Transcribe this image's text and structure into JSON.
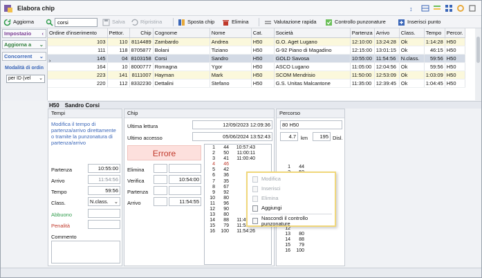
{
  "window": {
    "title": "Elabora chip"
  },
  "toolbar": {
    "aggiorna": "Aggiorna",
    "search_value": "corsi",
    "salva": "Salva",
    "ripristina": "Ripristina",
    "sposta_chip": "Sposta chip",
    "elimina": "Elimina",
    "valutazione_rapida": "Valutazione rapida",
    "controllo_punzonature": "Controllo punzonature",
    "inserisci_punto": "Inserisci punto"
  },
  "left": {
    "impostazioni": "Impostazio",
    "aggiorna_a": "Aggiorna a",
    "concorrenti": "Concorrent",
    "modalita": "Modalità di ordin",
    "per_id": "per ID (vel"
  },
  "grid": {
    "headers": [
      "Ordine d'inserimento",
      "Pettor.",
      "Chip",
      "Cognome",
      "Nome",
      "Cat.",
      "Società",
      "Partenza",
      "Arrivo",
      "Class.",
      "Tempo",
      "Percor."
    ],
    "rows": [
      [
        "103",
        "110",
        "8114489",
        "Zambardo",
        "Andrea",
        "H50",
        "G.O. Aget Lugano",
        "12:10:00",
        "13:24:28",
        "Ok",
        "1:14:28",
        "H50"
      ],
      [
        "111",
        "118",
        "8705877",
        "Bolani",
        "Tiziano",
        "H50",
        "G-92 Piano di Magadino",
        "12:15:00",
        "13:01:15",
        "Ok",
        "46:15",
        "H50"
      ],
      [
        "145",
        "04",
        "8103158",
        "Corsi",
        "Sandro",
        "H50",
        "GOLD Savosa",
        "10:55:00",
        "11:54:56",
        "N.class.",
        "59:56",
        "H50"
      ],
      [
        "164",
        "10",
        "8000777",
        "Romagna",
        "Ygor",
        "H50",
        "ASCO Lugano",
        "11:05:00",
        "12:04:56",
        "Ok",
        "59:56",
        "H50"
      ],
      [
        "223",
        "141",
        "8111007",
        "Hayman",
        "Mark",
        "H50",
        "SCOM Mendrisio",
        "11:50:00",
        "12:53:09",
        "Ok",
        "1:03:09",
        "H50"
      ],
      [
        "220",
        "112",
        "8332230",
        "Dettalini",
        "Stefano",
        "H50",
        "G.S. Unitas Malcantone",
        "11:35:00",
        "12:39:45",
        "Ok",
        "1:04:45",
        "H50"
      ]
    ]
  },
  "detail": {
    "cat": "H50",
    "name": "Sandro Corsi"
  },
  "tempi": {
    "header": "Tempi",
    "note": "Modifica il tempo di partenza/arrivo direttamente o tramite la punzonatura di partenza/arrivo",
    "partenza_label": "Partenza",
    "partenza_value": "10:55:00",
    "arrivo_label": "Arrivo",
    "arrivo_value": "11:54:56",
    "tempo_label": "Tempo",
    "tempo_value": "59:56",
    "class_label": "Class.",
    "class_value": "N.class.",
    "abbuono_label": "Abbuono",
    "penalita_label": "Penalità",
    "commento_label": "Commento"
  },
  "chip": {
    "header": "Chip",
    "ultima_lettura_label": "Ultima lettura",
    "ultima_lettura_value": "12/09/2023 12:09:36",
    "ultimo_accesso_label": "Ultimo accesso",
    "ultimo_accesso_value": "05/06/2024 13:52:43",
    "errore": "Errore",
    "elimina_label": "Elimina",
    "verifica_label": "Verifica",
    "verifica_value": "10:54:00",
    "partenza_label": "Partenza",
    "arrivo_label": "Arrivo",
    "arrivo_value": "11:54:55",
    "punches": [
      [
        "1",
        "44",
        "10:57:43"
      ],
      [
        "2",
        "50",
        "11:00:11"
      ],
      [
        "3",
        "41",
        "11:00:40"
      ],
      [
        "4",
        "46",
        ""
      ],
      [
        "5",
        "42",
        ""
      ],
      [
        "6",
        "36",
        ""
      ],
      [
        "7",
        "35",
        ""
      ],
      [
        "8",
        "67",
        ""
      ],
      [
        "9",
        "92",
        ""
      ],
      [
        "10",
        "80",
        ""
      ],
      [
        "11",
        "96",
        ""
      ],
      [
        "12",
        "90",
        ""
      ],
      [
        "13",
        "80",
        ""
      ],
      [
        "14",
        "88",
        "11:49:16"
      ],
      [
        "15",
        "79",
        "11:52:53"
      ],
      [
        "16",
        "100",
        "11:54:26"
      ]
    ]
  },
  "percorso": {
    "header": "Percorso",
    "id": "80",
    "name": "H50",
    "km_value": "4.7",
    "km_label": "km",
    "disl_value": "195",
    "disl_label": "Disl.",
    "punches": [
      [
        "1",
        "44"
      ],
      [
        "2",
        "50"
      ],
      [
        "3",
        "41"
      ],
      [
        "4",
        "46"
      ],
      [
        "5",
        ""
      ],
      [
        "6",
        ""
      ],
      [
        "7",
        ""
      ],
      [
        "8",
        ""
      ],
      [
        "9",
        ""
      ],
      [
        "10",
        ""
      ],
      [
        "11",
        ""
      ],
      [
        "12",
        ""
      ],
      [
        "13",
        "80"
      ],
      [
        "14",
        "88"
      ],
      [
        "15",
        "79"
      ],
      [
        "16",
        "100"
      ]
    ]
  },
  "context_menu": {
    "modifica": "Modifica",
    "inserisci": "Inserisci",
    "elimina": "Elimina",
    "aggiungi": "Aggiungi",
    "nascondi": "Nascondi il controllo punzonature"
  }
}
